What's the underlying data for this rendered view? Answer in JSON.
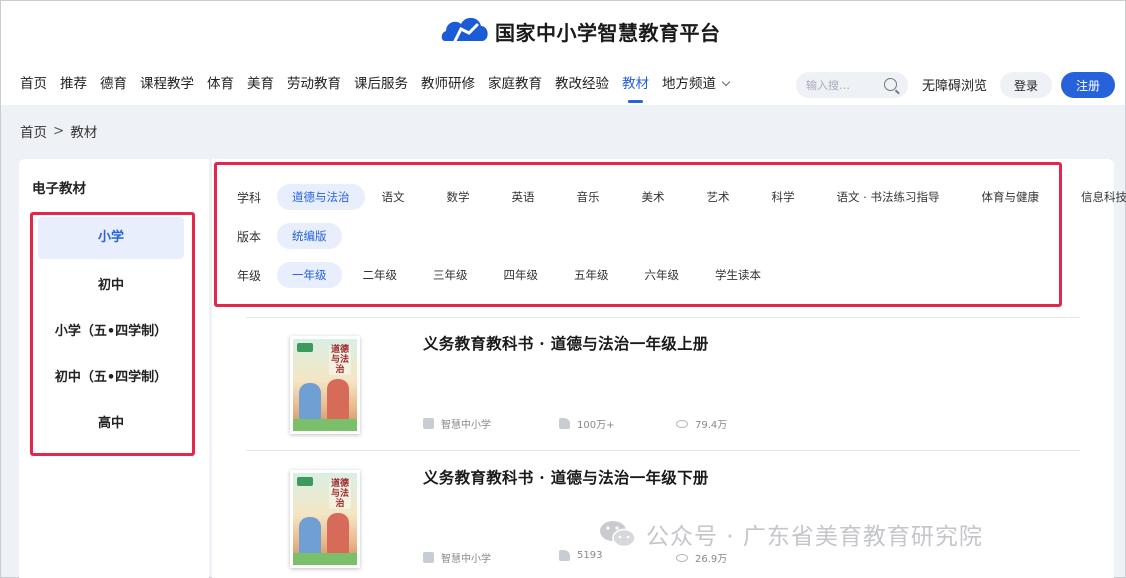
{
  "header": {
    "site_title": "国家中小学智慧教育平台",
    "nav": [
      {
        "label": "首页",
        "active": false
      },
      {
        "label": "推荐",
        "active": false
      },
      {
        "label": "德育",
        "active": false
      },
      {
        "label": "课程教学",
        "active": false
      },
      {
        "label": "体育",
        "active": false
      },
      {
        "label": "美育",
        "active": false
      },
      {
        "label": "劳动教育",
        "active": false
      },
      {
        "label": "课后服务",
        "active": false
      },
      {
        "label": "教师研修",
        "active": false
      },
      {
        "label": "家庭教育",
        "active": false
      },
      {
        "label": "教改经验",
        "active": false
      },
      {
        "label": "教材",
        "active": true
      },
      {
        "label": "地方频道",
        "active": false
      }
    ],
    "search_placeholder": "输入搜…",
    "accessibility": "无障碍浏览",
    "login": "登录",
    "register": "注册"
  },
  "breadcrumb": {
    "home": "首页",
    "sep": ">",
    "current": "教材"
  },
  "sidebar": {
    "title": "电子教材",
    "items": [
      "小学",
      "初中",
      "小学（五•四学制）",
      "初中（五•四学制）",
      "高中"
    ],
    "active_index": 0
  },
  "filters": {
    "subject_label": "学科",
    "subjects": [
      "道德与法治",
      "语文",
      "数学",
      "英语",
      "音乐",
      "美术",
      "艺术",
      "科学",
      "语文 · 书法练习指导",
      "体育与健康",
      "信息科技"
    ],
    "edition_label": "版本",
    "editions": [
      "统编版"
    ],
    "grade_label": "年级",
    "grades": [
      "一年级",
      "二年级",
      "三年级",
      "四年级",
      "五年级",
      "六年级",
      "学生读本"
    ]
  },
  "books": [
    {
      "title": "义务教育教科书 · 道德与法治一年级上册",
      "cover_title": "道德与法治",
      "source": "智慧中小学",
      "likes": "100万+",
      "views": "79.4万"
    },
    {
      "title": "义务教育教科书 · 道德与法治一年级下册",
      "cover_title": "道德与法治",
      "source": "智慧中小学",
      "likes": "5193",
      "views": "26.9万"
    }
  ],
  "watermark": "公众号 · 广东省美育教育研究院",
  "colors": {
    "accent": "#2662d9",
    "highlight_box": "#e3264c",
    "chip_bg": "#e8eefb",
    "page_bg": "#eef1f6"
  }
}
